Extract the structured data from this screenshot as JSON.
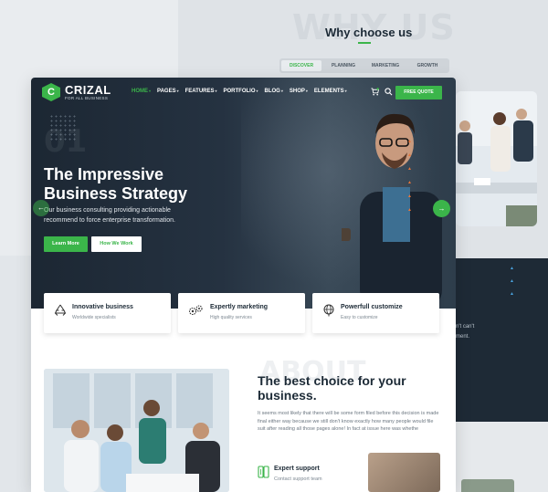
{
  "background": {
    "why_ghost": "WHY US",
    "why_title": "Why choose us",
    "tabs": [
      "DISCOVER",
      "PLANNING",
      "MARKETING",
      "GROWTH"
    ],
    "active_tab": "DISCOVER",
    "dark_panel_lines": [
      "n't can't",
      "ment."
    ]
  },
  "nav": {
    "logo_letter": "C",
    "logo_name": "CRIZAL",
    "logo_tagline": "FOR ALL BUSINESS",
    "items": [
      {
        "label": "HOME",
        "active": true
      },
      {
        "label": "PAGES"
      },
      {
        "label": "FEATURES"
      },
      {
        "label": "PORTFOLIO"
      },
      {
        "label": "BLOG"
      },
      {
        "label": "SHOP"
      },
      {
        "label": "ELEMENTS"
      }
    ],
    "cta": "FREE QUOTE"
  },
  "hero": {
    "number": "01",
    "title": "The Impressive Business Strategy",
    "description": "Our business consulting providing actionable recommend to force enterprise transformation.",
    "primary_button": "Learn More",
    "secondary_button": "How We Work"
  },
  "features": [
    {
      "title": "Innovative business",
      "subtitle": "Worldwide specialists",
      "icon": "recycle-icon"
    },
    {
      "title": "Expertly marketing",
      "subtitle": "High quality services",
      "icon": "gears-icon"
    },
    {
      "title": "Powerfull customize",
      "subtitle": "Easy to customize",
      "icon": "globe-icon"
    }
  ],
  "about": {
    "ghost": "ABOUT",
    "title": "The best choice for your business.",
    "description": "It seems most likely that there will be some form filed before this decision is made final either way because we still don't know exactly how many people would file suit after reading all those pages alone! In fact at issue here was whethe",
    "support_title": "Expert support",
    "support_subtitle": "Contact support team"
  },
  "colors": {
    "accent": "#3bb54a",
    "dark": "#1c2733",
    "orange": "#e8763a"
  }
}
